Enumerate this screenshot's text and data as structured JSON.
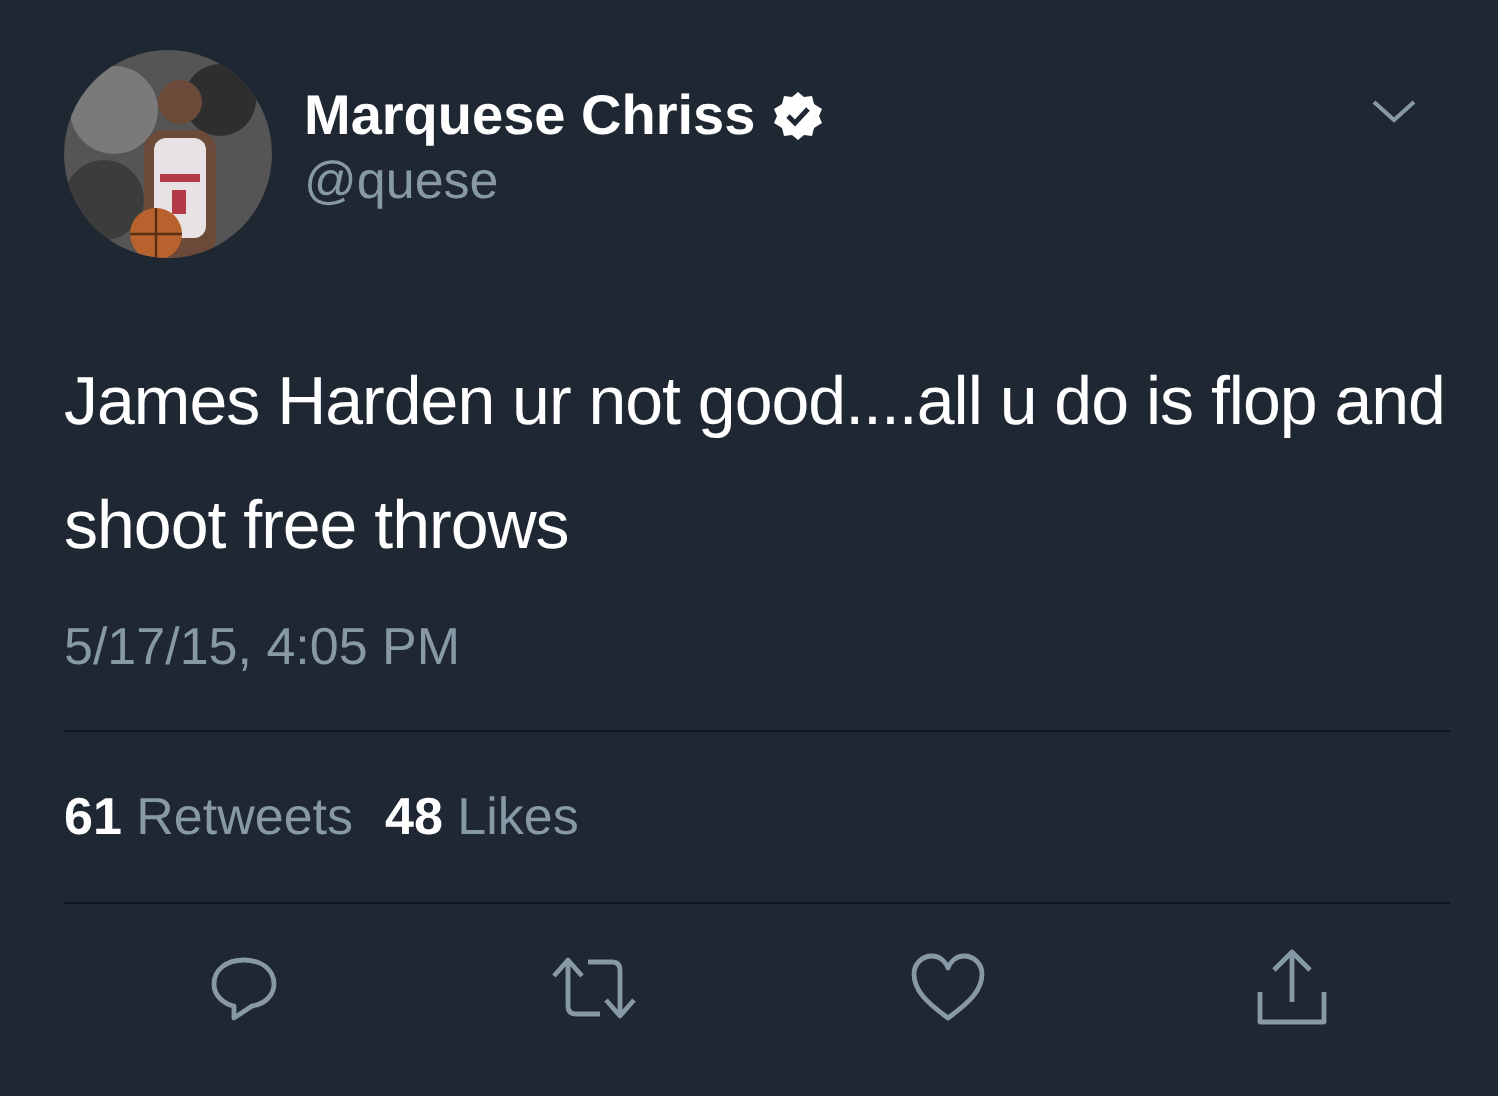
{
  "author": {
    "name": "Marquese Chriss",
    "verified": true,
    "handle": "@quese"
  },
  "text": "James Harden ur not good....all u do is flop and shoot free throws",
  "timestamp": "5/17/15, 4:05 PM",
  "stats": [
    {
      "count": "61",
      "label": "Retweets"
    },
    {
      "count": "48",
      "label": "Likes"
    }
  ]
}
